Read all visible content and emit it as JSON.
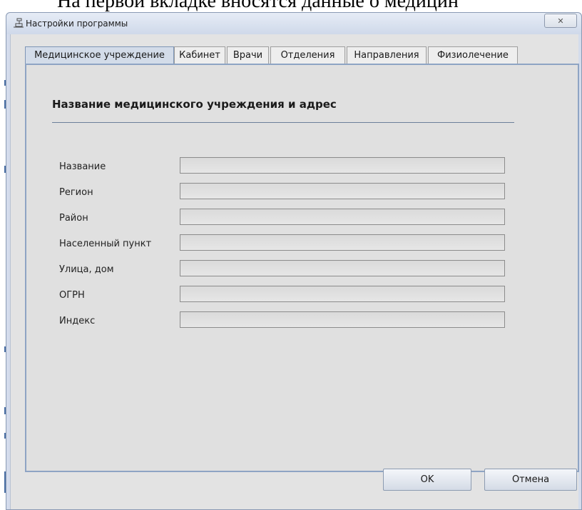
{
  "document": {
    "caption_fragment": "На первой вкладке вносятся данные о медицин"
  },
  "window": {
    "title": "Настройки программы",
    "close_glyph": "✕"
  },
  "tabs": [
    {
      "label": "Медицинское учреждение",
      "active": true
    },
    {
      "label": "Кабинет",
      "active": false
    },
    {
      "label": "Врачи",
      "active": false
    },
    {
      "label": "Отделения",
      "active": false
    },
    {
      "label": "Направления",
      "active": false
    },
    {
      "label": "Физиолечение",
      "active": false
    }
  ],
  "panel": {
    "section_title": "Название медицинского учреждения и адрес",
    "fields": [
      {
        "label": "Название",
        "value": ""
      },
      {
        "label": "Регион",
        "value": ""
      },
      {
        "label": "Район",
        "value": ""
      },
      {
        "label": "Населенный пункт",
        "value": ""
      },
      {
        "label": "Улица, дом",
        "value": ""
      },
      {
        "label": "ОГРН",
        "value": ""
      },
      {
        "label": "Индекс",
        "value": ""
      }
    ]
  },
  "buttons": {
    "ok_label": "OK",
    "cancel_label": "Отмена"
  }
}
